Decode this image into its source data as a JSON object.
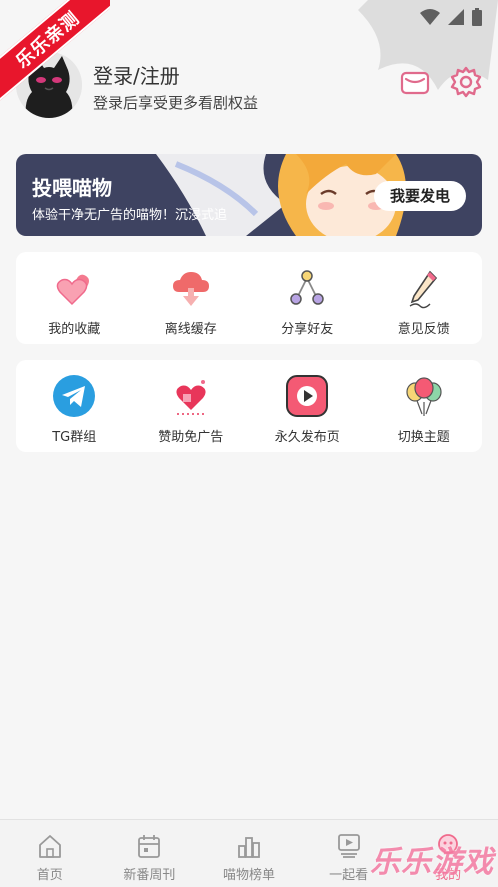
{
  "ribbon": "乐乐亲测",
  "profile": {
    "title": "登录/注册",
    "subtitle": "登录后享受更多看剧权益"
  },
  "banner": {
    "title": "投喂喵物",
    "subtitle": "体验干净无广告的喵物！沉浸式追",
    "button": "我要发电"
  },
  "grid1": [
    {
      "label": "我的收藏",
      "icon": "hearts-icon"
    },
    {
      "label": "离线缓存",
      "icon": "cloud-download-icon"
    },
    {
      "label": "分享好友",
      "icon": "share-icon"
    },
    {
      "label": "意见反馈",
      "icon": "pencil-icon"
    }
  ],
  "grid2": [
    {
      "label": "TG群组",
      "icon": "telegram-icon"
    },
    {
      "label": "赞助免广告",
      "icon": "heart-gift-icon"
    },
    {
      "label": "永久发布页",
      "icon": "play-icon"
    },
    {
      "label": "切换主题",
      "icon": "balloons-icon"
    }
  ],
  "nav": [
    {
      "label": "首页",
      "icon": "home-icon"
    },
    {
      "label": "新番周刊",
      "icon": "calendar-icon"
    },
    {
      "label": "喵物榜单",
      "icon": "ranking-icon"
    },
    {
      "label": "一起看",
      "icon": "video-icon"
    },
    {
      "label": "我的",
      "icon": "profile-icon",
      "active": true
    }
  ],
  "watermark": "乐乐游戏",
  "colors": {
    "banner_bg": "#3e4361",
    "ribbon": "#e8162c",
    "accent": "#f06a8c"
  }
}
